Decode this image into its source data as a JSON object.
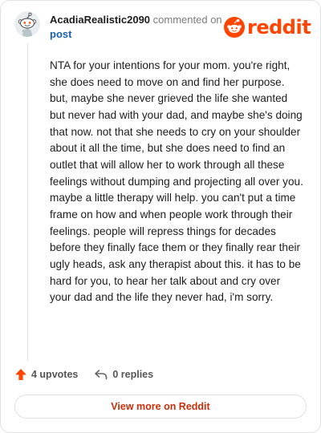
{
  "comment": {
    "author": "AcadiaRealistic2090",
    "commented_on": "commented on",
    "post_link": "post",
    "body": "NTA for your intentions for your mom. you're right, she does need to move on and find her purpose. but, maybe she never grieved the life she wanted but never had with your dad, and maybe she's doing that now. not that she needs to cry on your shoulder about it all the time, but she does need to find an outlet that will allow her to work through all these feelings without dumping and projecting all over you. maybe a little therapy will help. you can't put a time frame on how and when people work through their feelings. people will repress things for decades before they finally face them or they finally rear their ugly heads, ask any therapist about this. it has to be hard for you, to hear her talk about and cry over your dad and the life they never had, i'm sorry."
  },
  "brand": {
    "name": "reddit",
    "icon": "reddit-snoo-icon",
    "color": "#ff4500"
  },
  "actions": {
    "upvotes": "4 upvotes",
    "replies": "0 replies",
    "upvote_icon": "upvote-arrow-icon",
    "reply_icon": "reply-arrow-icon",
    "upvote_color": "#ff4500"
  },
  "footer": {
    "view_more": "View more on Reddit"
  }
}
